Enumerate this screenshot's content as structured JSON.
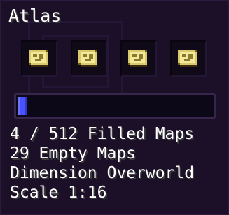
{
  "atlas": {
    "title": "Atlas",
    "slots": [
      {
        "icon": "map-icon"
      },
      {
        "icon": "map-icon"
      },
      {
        "icon": "map-icon"
      },
      {
        "icon": "map-icon"
      }
    ],
    "progress": {
      "filled": 4,
      "total": 512,
      "fraction": 0.0078,
      "color": "#4a52ff"
    },
    "filled_text": "4 / 512 Filled Maps",
    "empty_text": "29 Empty Maps",
    "dimension_text": "Dimension Overworld",
    "scale_text": "Scale 1:16"
  }
}
